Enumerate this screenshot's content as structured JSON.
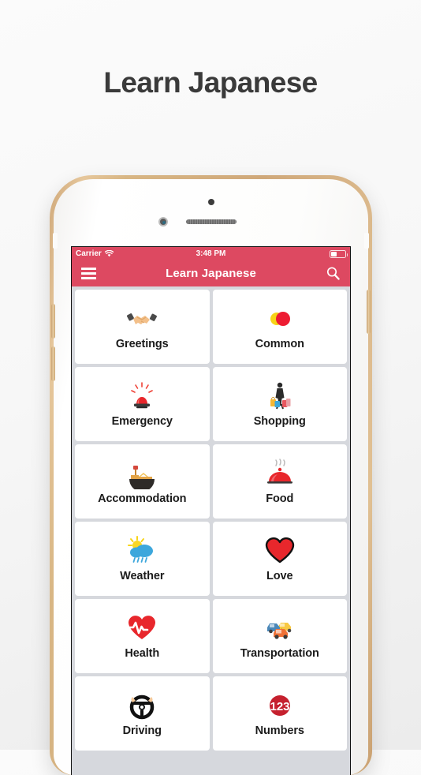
{
  "page": {
    "heading": "Learn Japanese"
  },
  "phone": {
    "hardware": {
      "camera_icon": "front-camera",
      "sensor_icon": "proximity-sensor",
      "speaker_icon": "earpiece-speaker",
      "volume_up_icon": "volume-up-button",
      "volume_down_icon": "volume-down-button",
      "power_icon": "power-button"
    },
    "statusbar": {
      "carrier": "Carrier",
      "wifi_icon": "wifi-icon",
      "time": "3:48 PM",
      "battery_icon": "battery-icon",
      "battery_level_pct": 40
    },
    "navbar": {
      "menu_icon": "hamburger-menu-icon",
      "title": "Learn Japanese",
      "search_icon": "search-icon",
      "background_color": "#dd4961"
    },
    "grid": {
      "background_color": "#d6d8dd",
      "items": [
        {
          "label": "Greetings",
          "icon": "handshake-icon"
        },
        {
          "label": "Common",
          "icon": "chat-bubbles-icon"
        },
        {
          "label": "Emergency",
          "icon": "siren-icon"
        },
        {
          "label": "Shopping",
          "icon": "shopping-bags-icon"
        },
        {
          "label": "Accommodation",
          "icon": "bed-icon"
        },
        {
          "label": "Food",
          "icon": "food-cloche-icon"
        },
        {
          "label": "Weather",
          "icon": "sun-behind-rain-cloud-icon"
        },
        {
          "label": "Love",
          "icon": "heart-icon"
        },
        {
          "label": "Health",
          "icon": "heart-pulse-icon"
        },
        {
          "label": "Transportation",
          "icon": "cars-icon"
        },
        {
          "label": "Driving",
          "icon": "steering-wheel-icon"
        },
        {
          "label": "Numbers",
          "icon": "numbers-123-icon"
        }
      ]
    }
  }
}
